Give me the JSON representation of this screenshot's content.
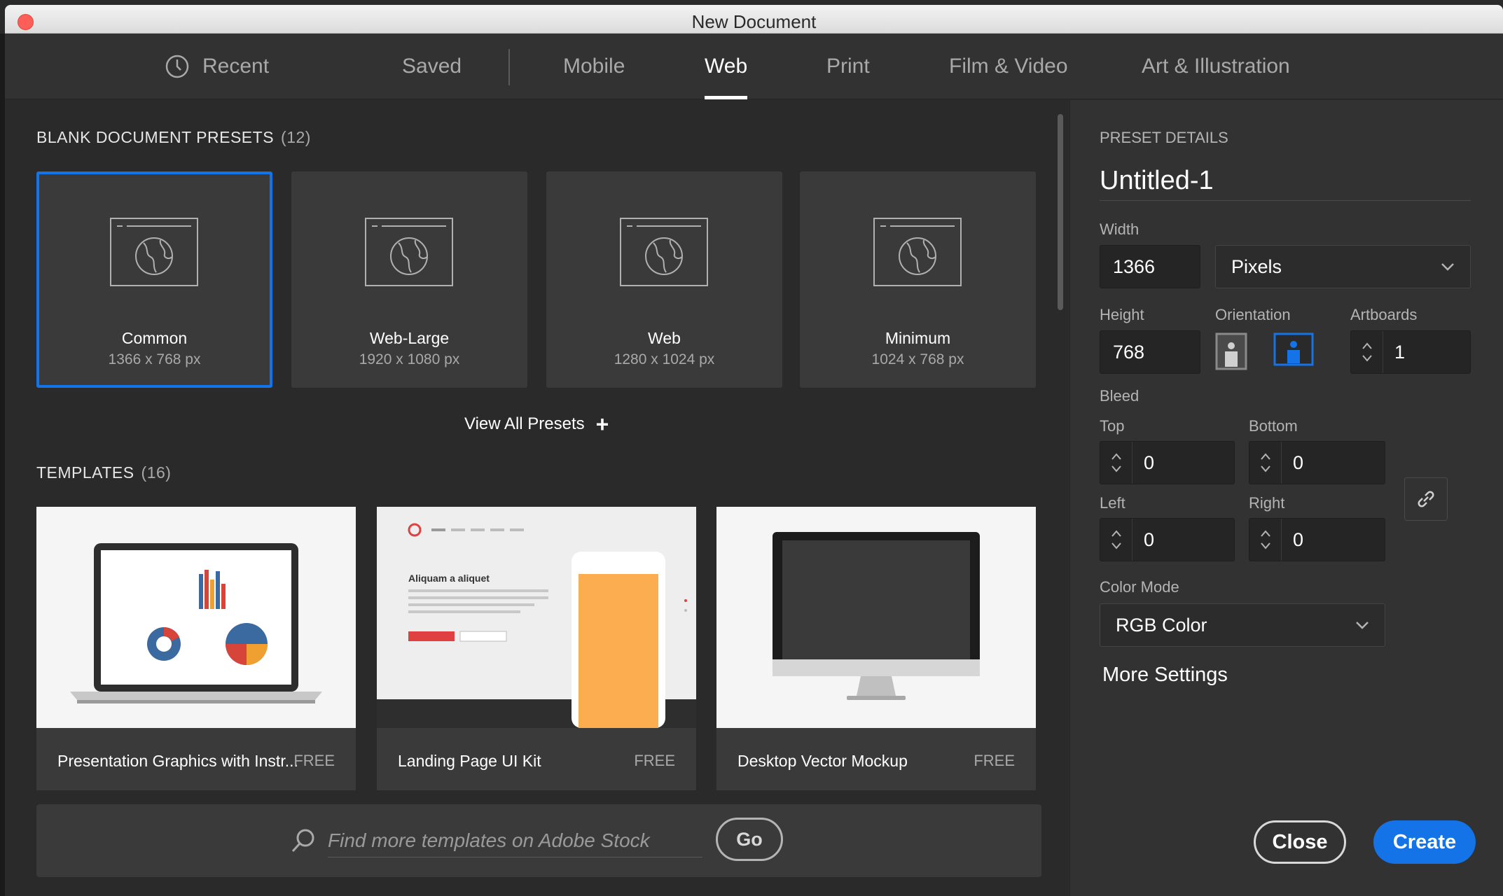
{
  "window": {
    "title": "New Document"
  },
  "tabs": [
    {
      "label": "Recent",
      "icon": "clock-icon"
    },
    {
      "label": "Saved"
    },
    {
      "label": "Mobile"
    },
    {
      "label": "Web",
      "active": true
    },
    {
      "label": "Print"
    },
    {
      "label": "Film & Video"
    },
    {
      "label": "Art & Illustration"
    }
  ],
  "presets_section": {
    "title": "BLANK DOCUMENT PRESETS",
    "count": "(12)"
  },
  "presets": [
    {
      "name": "Common",
      "size": "1366 x 768 px",
      "selected": true
    },
    {
      "name": "Web-Large",
      "size": "1920 x 1080 px"
    },
    {
      "name": "Web",
      "size": "1280 x 1024 px"
    },
    {
      "name": "Minimum",
      "size": "1024 x 768 px"
    }
  ],
  "view_all": {
    "label": "View All Presets",
    "icon": "plus-icon"
  },
  "templates_section": {
    "title": "TEMPLATES",
    "count": "(16)"
  },
  "templates": [
    {
      "name": "Presentation Graphics with Instr...",
      "price": "FREE"
    },
    {
      "name": "Landing Page UI Kit",
      "price": "FREE",
      "thumb_text": "Aliquam a aliquet"
    },
    {
      "name": "Desktop Vector Mockup",
      "price": "FREE"
    }
  ],
  "search": {
    "placeholder": "Find more templates on Adobe Stock",
    "go_label": "Go"
  },
  "details": {
    "header": "PRESET DETAILS",
    "doc_name": "Untitled-1",
    "width_label": "Width",
    "width_value": "1366",
    "unit": "Pixels",
    "height_label": "Height",
    "height_value": "768",
    "orientation_label": "Orientation",
    "orientation_selected": "landscape",
    "artboards_label": "Artboards",
    "artboards_value": "1",
    "bleed_label": "Bleed",
    "top_label": "Top",
    "top_value": "0",
    "bottom_label": "Bottom",
    "bottom_value": "0",
    "left_label": "Left",
    "left_value": "0",
    "right_label": "Right",
    "right_value": "0",
    "color_mode_label": "Color Mode",
    "color_mode_value": "RGB Color",
    "more_settings": "More Settings",
    "close_label": "Close",
    "create_label": "Create"
  },
  "colors": {
    "accent": "#1473e6",
    "panel": "#323232",
    "background": "#2a2a2a",
    "close_dot": "#fc5f57",
    "template_orange": "#fbad4f"
  }
}
